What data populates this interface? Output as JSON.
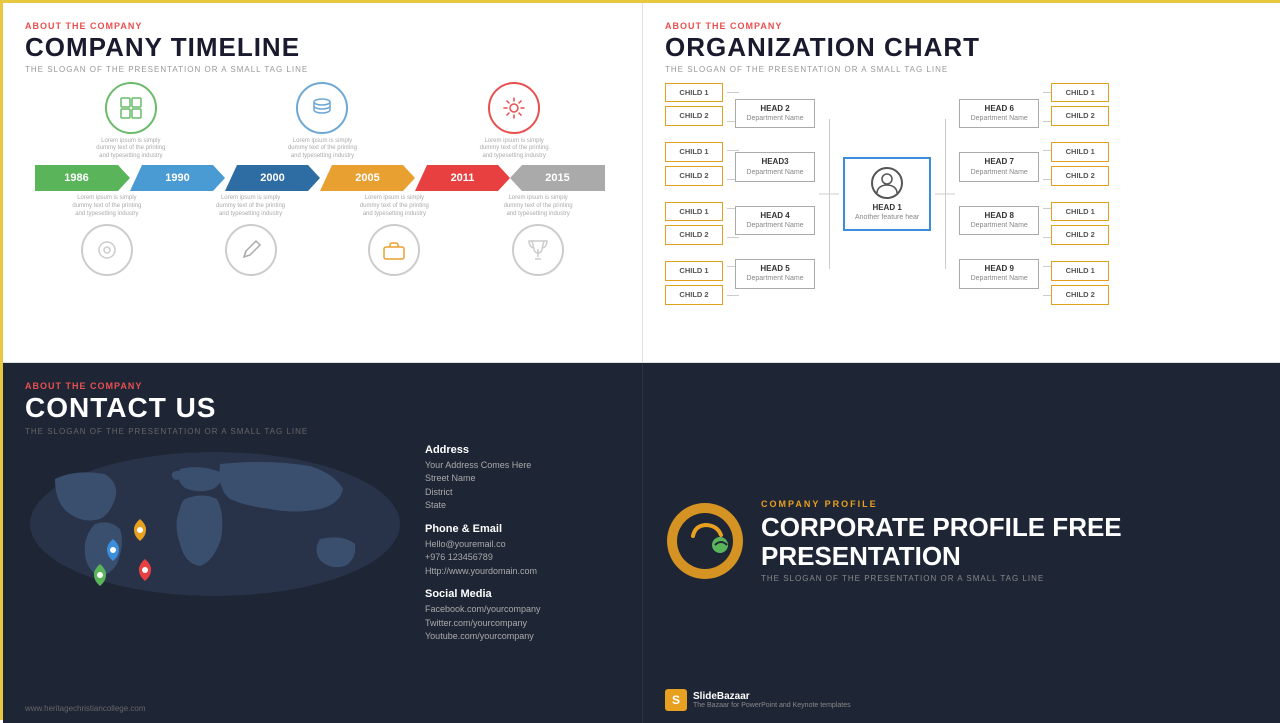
{
  "timeline": {
    "about": "ABOUT THE COMPANY",
    "title": "COMPANY TIMELINE",
    "tagline": "THE SLOGAN OF THE PRESENTATION OR A SMALL TAG LINE",
    "icons_top": [
      {
        "id": "cubes",
        "symbol": "⊞",
        "color": "green",
        "desc": "Lorem ipsum is simply dummy text of the printing and typesetting industry"
      },
      {
        "id": "database",
        "symbol": "🗄",
        "color": "blue",
        "desc": "Lorem ipsum is simply dummy text of the printing and typesetting industry"
      },
      {
        "id": "gear",
        "symbol": "⚙",
        "color": "red",
        "desc": "Lorem ipsum is simply dummy text of the printing and typesetting industry"
      }
    ],
    "years": [
      "1986",
      "1990",
      "2000",
      "2005",
      "2011",
      "2015"
    ],
    "icons_bottom": [
      {
        "symbol": "◌",
        "desc": "Lorem ipsum is simply dummy text of the printing and typesetting industry"
      },
      {
        "symbol": "✏",
        "desc": "Lorem ipsum is simply dummy text of the printing and typesetting industry"
      },
      {
        "symbol": "💼",
        "desc": "Lorem ipsum is simply dummy text of the printing and typesetting industry"
      },
      {
        "symbol": "🏆",
        "desc": "Lorem ipsum is simply dummy text of the printing and typesetting industry"
      }
    ]
  },
  "orgchart": {
    "about": "ABOUT THE COMPANY",
    "title": "ORGANIZATION CHART",
    "tagline": "THE SLOGAN OF THE PRESENTATION OR A SMALL TAG LINE",
    "center": {
      "name": "HEAD 1",
      "desc": "Another feature hear"
    },
    "left_heads": [
      {
        "name": "HEAD 2",
        "dept": "Department Name",
        "children": [
          "CHILD 1",
          "CHILD 2"
        ]
      },
      {
        "name": "HEAD3",
        "dept": "Department Name",
        "children": [
          "CHILD 1",
          "CHILD 2"
        ]
      },
      {
        "name": "HEAD 4",
        "dept": "Department Name",
        "children": [
          "CHILD 1",
          "CHILD 2"
        ]
      },
      {
        "name": "HEAD 5",
        "dept": "Department Name",
        "children": [
          "CHILD 1",
          "CHILD 2"
        ]
      }
    ],
    "right_heads": [
      {
        "name": "HEAD 6",
        "dept": "Department Name",
        "children": [
          "CHILD 1",
          "CHILD 2"
        ]
      },
      {
        "name": "HEAD 7",
        "dept": "Department Name",
        "children": [
          "CHILD 1",
          "CHILD 2"
        ]
      },
      {
        "name": "HEAD 8",
        "dept": "Department Name",
        "children": [
          "CHILD 1",
          "CHILD 2"
        ]
      },
      {
        "name": "HEAD 9",
        "dept": "Department Name",
        "children": [
          "CHILD 1",
          "CHILD 2"
        ]
      }
    ]
  },
  "contact": {
    "about": "ABOUT THE COMPANY",
    "title": "CONTACT US",
    "tagline": "THE SLOGAN OF THE PRESENTATION OR A SMALL TAG LINE",
    "address_title": "Address",
    "address_lines": [
      "Your Address Comes Here",
      "Street Name",
      "District",
      "State"
    ],
    "phone_title": "Phone & Email",
    "phone_lines": [
      "Hello@youremail.co",
      "+976 123456789",
      "Http://www.yourdomain.com"
    ],
    "social_title": "Social Media",
    "social_lines": [
      "Facebook.com/yourcompany",
      "Twitter.com/yourcompany",
      "Youtube.com/yourcompany"
    ],
    "website": "www.heritagechristiancollege.com"
  },
  "corporate": {
    "profile_label": "COMPANY PROFILE",
    "title": "CORPORATE PROFILE FREE PRESENTATION",
    "tagline": "THE SLOGAN OF THE PRESENTATION OR A SMALL TAG LINE",
    "slidebazaar_name": "SlideBazaar",
    "slidebazaar_sub": "The Bazaar for PowerPoint and Keynote templates"
  }
}
